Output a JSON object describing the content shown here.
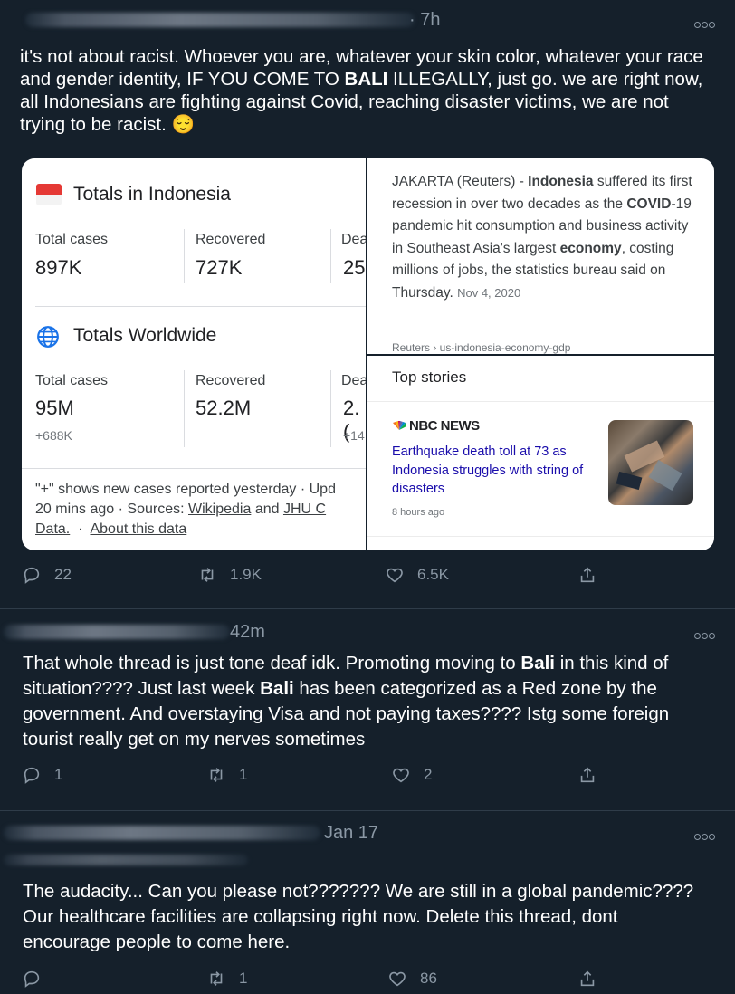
{
  "tweets": [
    {
      "time": "· 7h",
      "text_html": "it's not about racist. Whoever you are, whatever your skin color, whatever your race and gender identity, IF YOU COME TO <b>BALI</b> ILLEGALLY, just go. we are right now, all Indonesians are fighting against Covid, reaching disaster victims, we are not trying to be racist. 😌",
      "replies": "22",
      "retweets": "1.9K",
      "likes": "6.5K"
    },
    {
      "time": "42m",
      "text_html": "That whole thread is just tone deaf idk. Promoting moving to <b>Bali</b> in this kind of situation???? Just last week <b>Bali</b> has been categorized as a Red zone by the government. And overstaying Visa and not paying taxes???? Istg some foreign tourist really get on my nerves sometimes",
      "replies": "1",
      "retweets": "1",
      "likes": "2"
    },
    {
      "time": "Jan 17",
      "text_html": "The audacity... Can you please not??????? We are still in a global pandemic???? Our healthcare facilities are collapsing right now. Delete this thread, dont encourage people to come here.",
      "replies": "",
      "retweets": "1",
      "likes": "86"
    }
  ],
  "covid_card": {
    "indonesia": {
      "title": "Totals in Indonesia",
      "labels": [
        "Total cases",
        "Recovered",
        "Dea"
      ],
      "values": [
        "897K",
        "727K",
        "25"
      ]
    },
    "worldwide": {
      "title": "Totals Worldwide",
      "labels": [
        "Total cases",
        "Recovered",
        "Dea"
      ],
      "values": [
        "95M",
        "52.2M",
        "2.("
      ],
      "subs": [
        "+688K",
        "+14"
      ]
    },
    "footnote": {
      "line": "\"+\" shows new cases reported yesterday · Upd",
      "updated": "20 mins ago",
      "sources_prefix": "·  Sources:",
      "wikipedia": "Wikipedia",
      "and": "and",
      "jhu": "JHU C",
      "data": "Data.",
      "about": "About this data"
    }
  },
  "news": {
    "text_html": "JAKARTA (Reuters) - <b>Indonesia</b> suffered its first recession in over two decades as the <b>COVID</b>-19 pandemic hit consumption and business activity in Southeast Asia's largest <b>economy</b>, costing millions of jobs, the statistics bureau said on Thursday.",
    "date": "Nov 4, 2020",
    "source": "Reuters › us-indonesia-economy-gdp"
  },
  "top_stories": {
    "heading": "Top stories",
    "publisher": "NBC NEWS",
    "headline": "Earthquake death toll at 73 as Indonesia struggles with string of disasters",
    "ago": "8 hours ago"
  },
  "colors": {
    "background": "#15202b",
    "muted": "#8b98a5",
    "link_blue": "#1a0dab"
  }
}
